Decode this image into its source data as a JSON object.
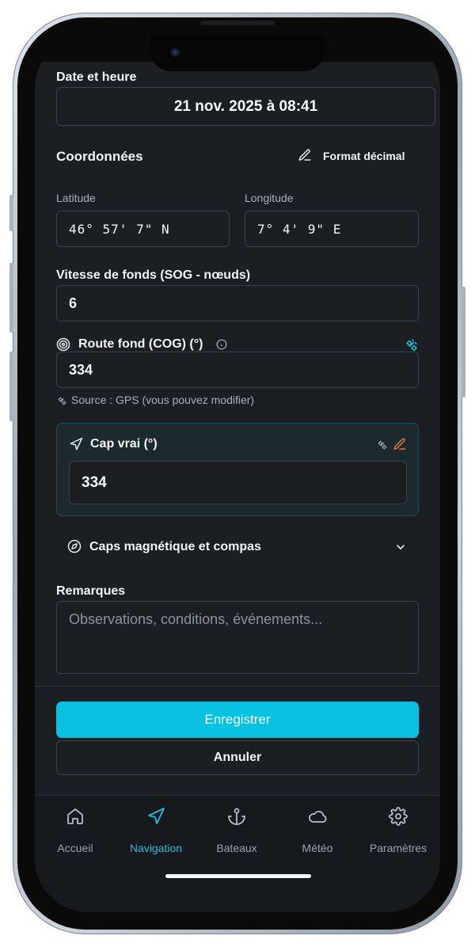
{
  "form": {
    "date_label": "Date et heure",
    "date_value": "21 nov. 2025 à 08:41",
    "coords_label": "Coordonnées",
    "format_button": "Format décimal",
    "latitude_label": "Latitude",
    "latitude_value": "46° 57' 7\" N",
    "longitude_label": "Longitude",
    "longitude_value": "7° 4' 9\" E",
    "sog_label": "Vitesse de fonds (SOG - nœuds)",
    "sog_value": "6",
    "cog_label": "Route fond (COG) (°)",
    "cog_value": "334",
    "cog_source": "Source : GPS (vous pouvez modifier)",
    "cap_label": "Cap vrai (°)",
    "cap_value": "334",
    "magnetic_label": "Caps magnétique et compas",
    "remarks_label": "Remarques",
    "remarks_placeholder": "Observations, conditions, événements..."
  },
  "actions": {
    "save": "Enregistrer",
    "cancel": "Annuler"
  },
  "tabs": [
    {
      "label": "Accueil",
      "icon": "home-icon",
      "active": false
    },
    {
      "label": "Navigation",
      "icon": "navigation-icon",
      "active": true
    },
    {
      "label": "Bateaux",
      "icon": "anchor-icon",
      "active": false
    },
    {
      "label": "Météo",
      "icon": "cloud-icon",
      "active": false
    },
    {
      "label": "Paramètres",
      "icon": "settings-icon",
      "active": false
    }
  ],
  "colors": {
    "accent": "#08c0e0",
    "background": "#1b1f24",
    "card_background": "#1c2a2e",
    "edit_icon": "#e8743a"
  }
}
